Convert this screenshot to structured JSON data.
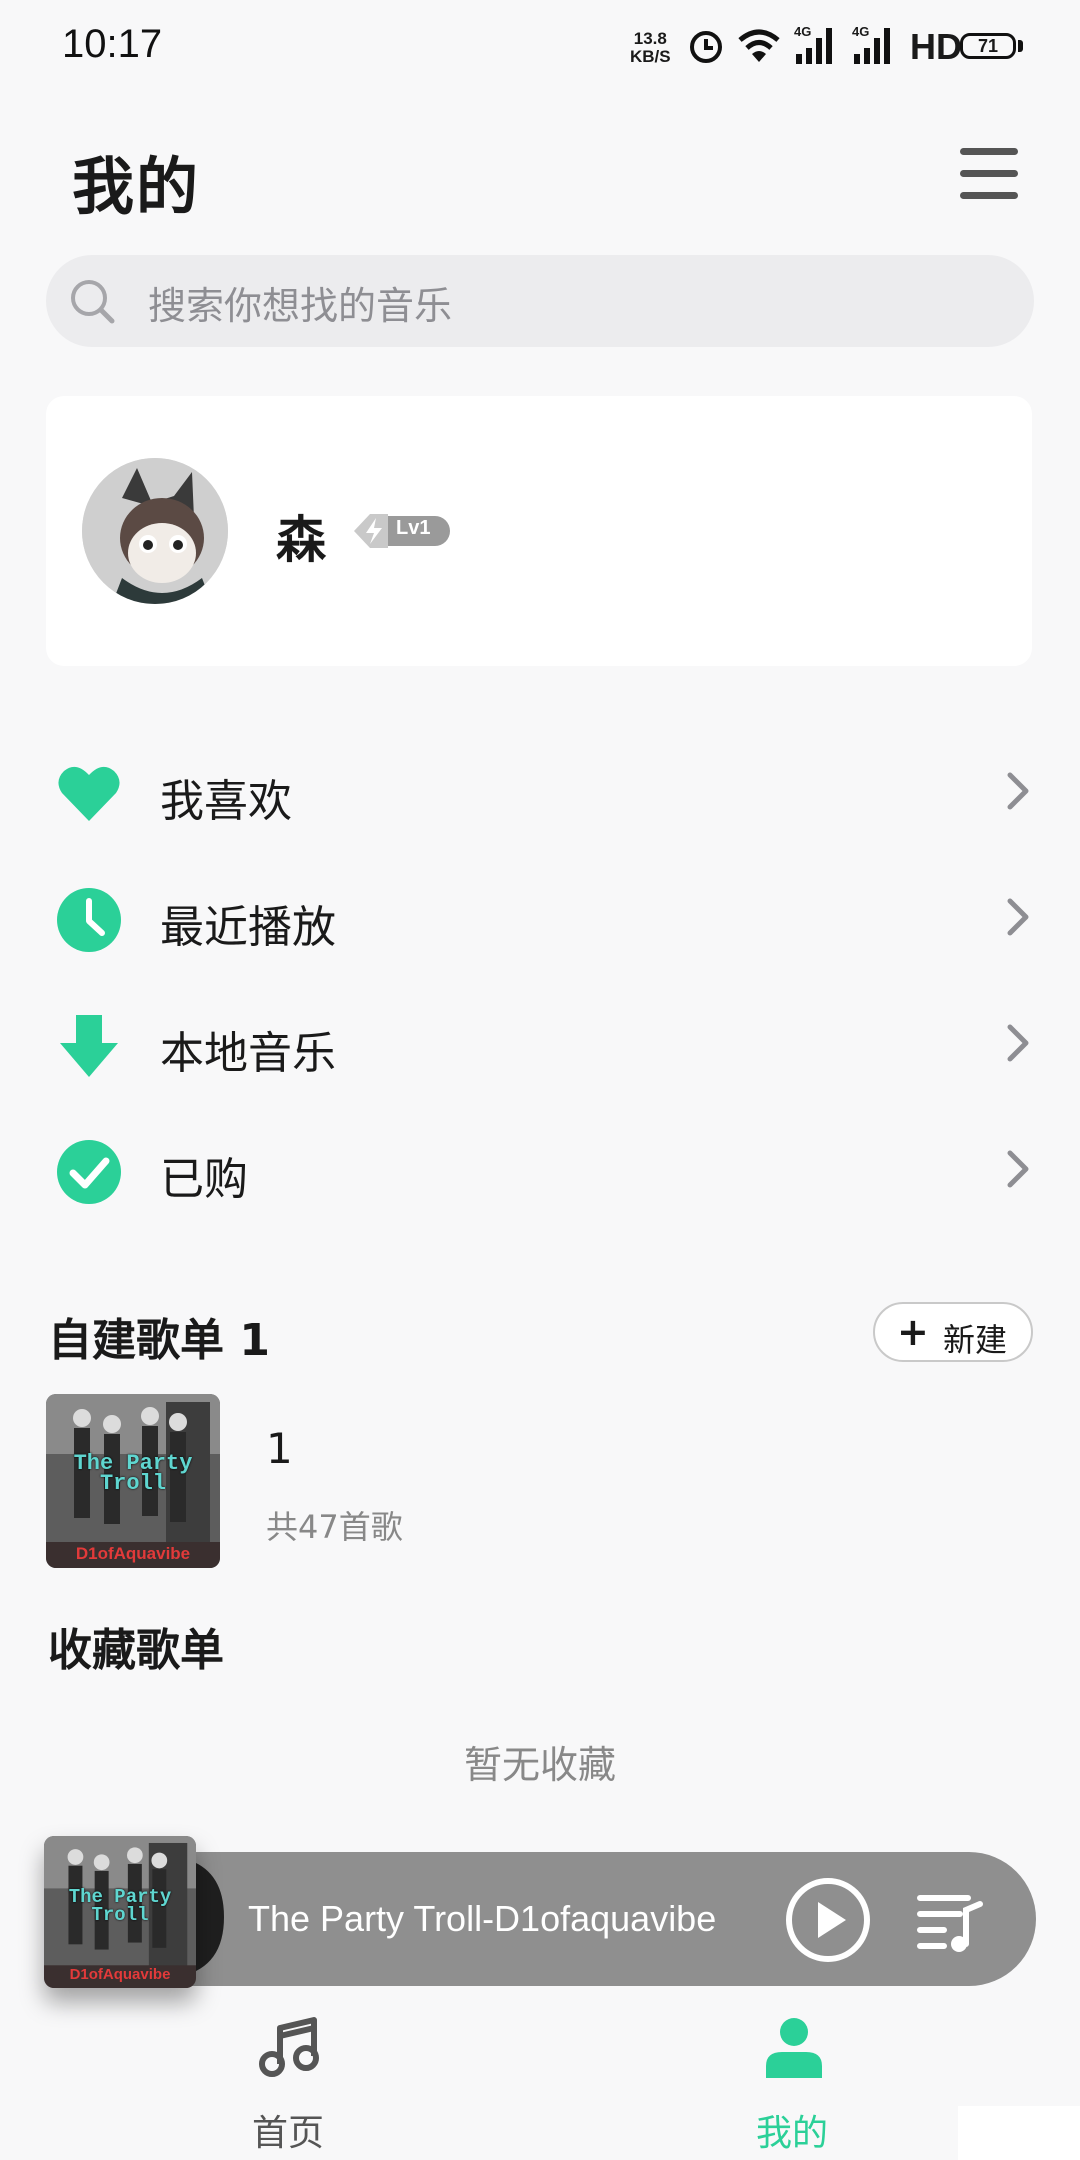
{
  "status_bar": {
    "time": "10:17",
    "network_speed_value": "13.8",
    "network_speed_unit": "KB/S",
    "signal_1_label": "4G",
    "signal_2_label": "4G",
    "hd_label": "HD",
    "battery_level": "71"
  },
  "header": {
    "title": "我的",
    "menu_icon": "hamburger-menu-icon"
  },
  "search": {
    "placeholder": "搜索你想找的音乐"
  },
  "profile": {
    "username": "森",
    "level": "Lv1"
  },
  "menu": {
    "items": [
      {
        "label": "我喜欢",
        "icon": "heart-icon"
      },
      {
        "label": "最近播放",
        "icon": "clock-icon"
      },
      {
        "label": "本地音乐",
        "icon": "download-arrow-icon"
      },
      {
        "label": "已购",
        "icon": "check-circle-icon"
      }
    ]
  },
  "self_playlists": {
    "header": "自建歌单 1",
    "new_button": "新建",
    "items": [
      {
        "name": "1",
        "count": "共47首歌"
      }
    ],
    "cover_title": "The Party Troll",
    "cover_artist": "D1ofAquavibe"
  },
  "favorite_playlists": {
    "header": "收藏歌单",
    "empty_text": "暂无收藏"
  },
  "player": {
    "now_playing": "The Party Troll-D1ofaquavibe"
  },
  "bottom_nav": {
    "tabs": [
      {
        "label": "首页",
        "active": false
      },
      {
        "label": "我的",
        "active": true
      }
    ]
  },
  "colors": {
    "accent": "#2bd098",
    "player_bg": "#8f8f8f",
    "page_bg": "#f8f8f9"
  }
}
